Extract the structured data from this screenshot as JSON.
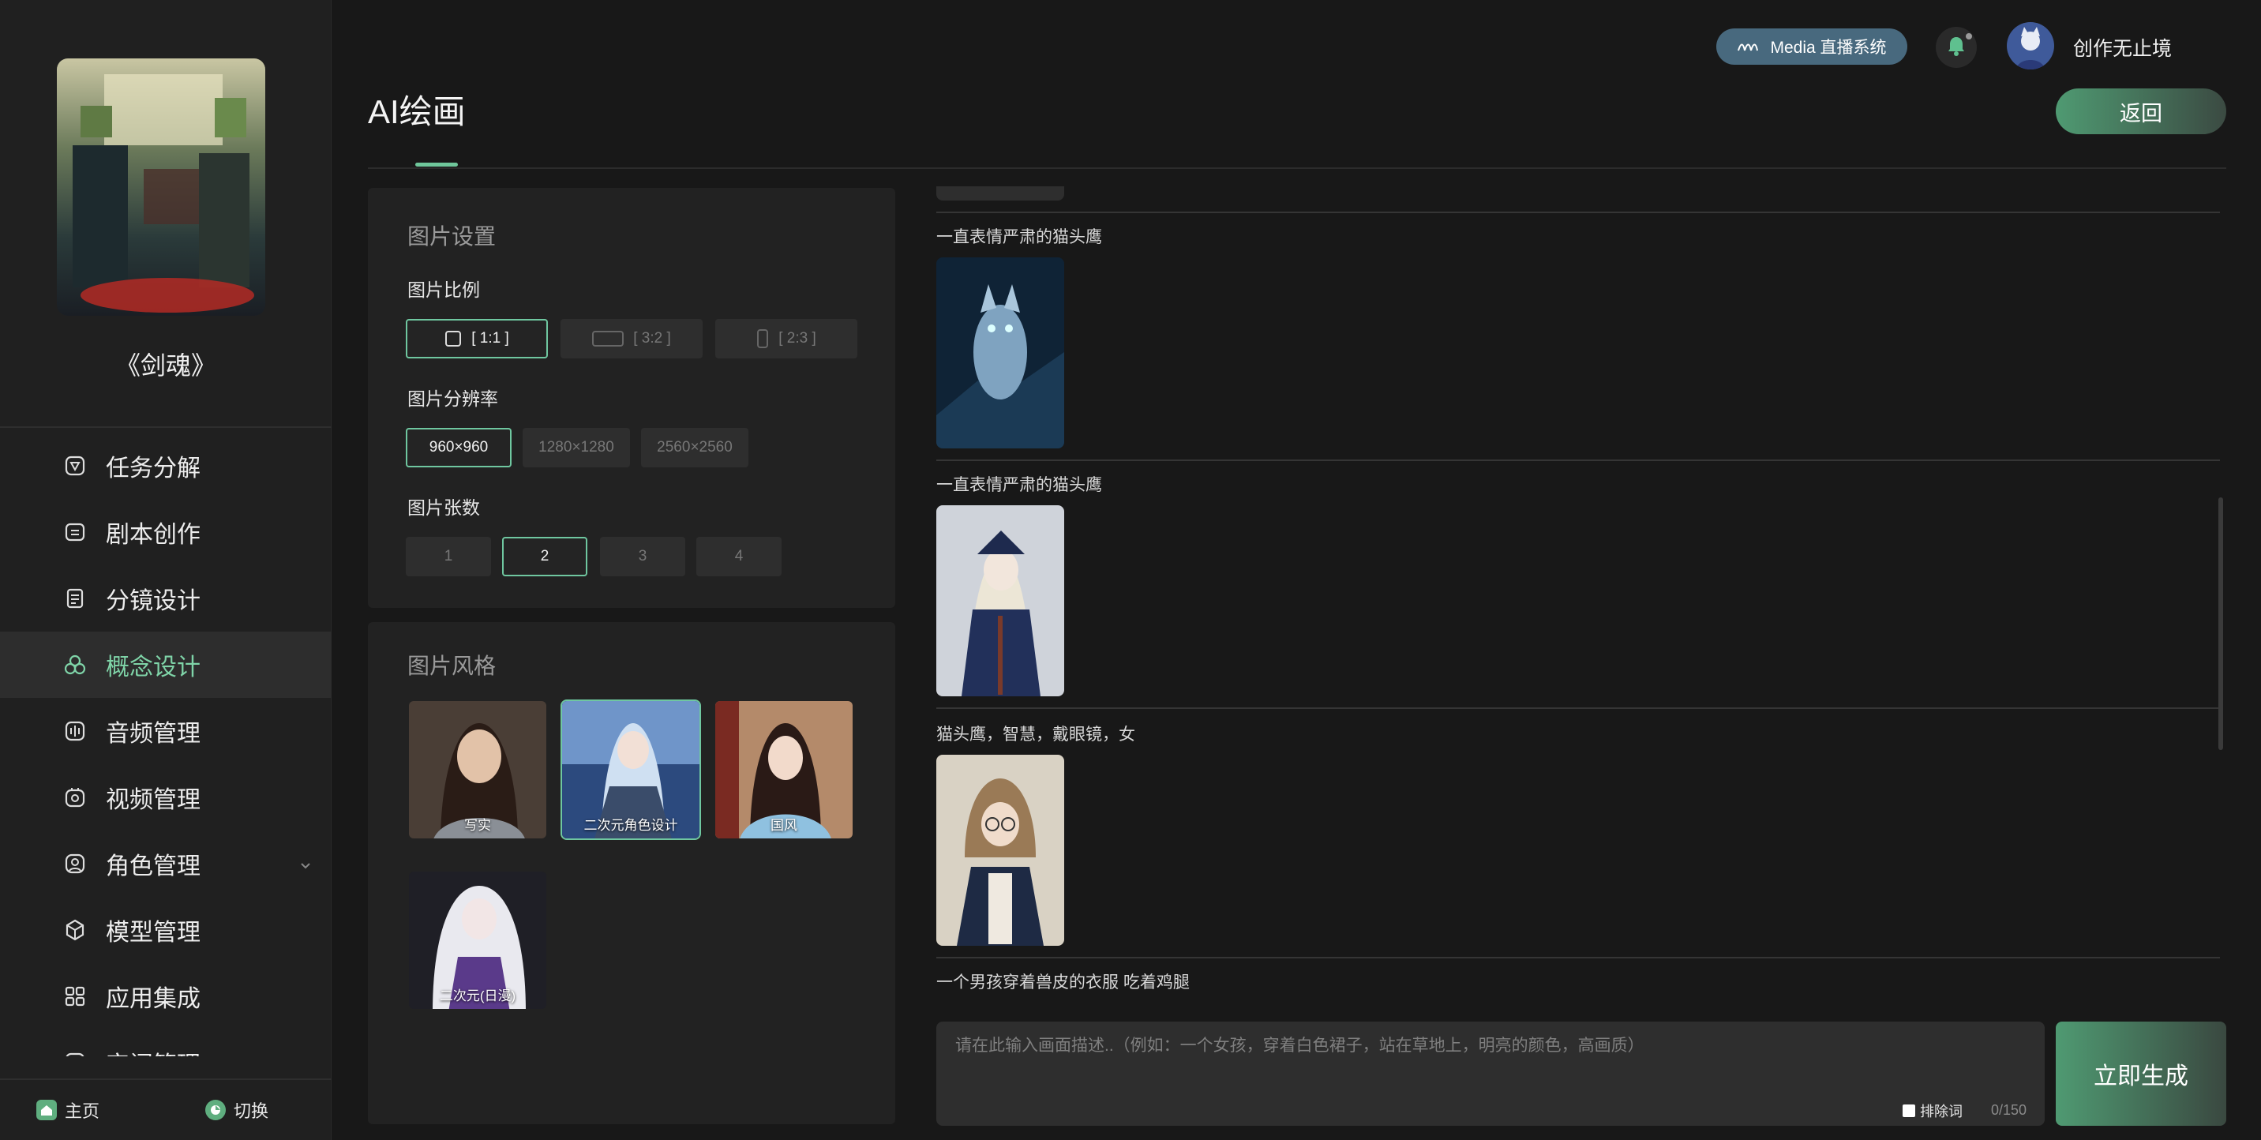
{
  "app": {
    "page_title": "AI绘画"
  },
  "sidebar": {
    "project_name": "《剑魂》",
    "items": [
      {
        "label": "任务分解",
        "icon": "task-icon"
      },
      {
        "label": "剧本创作",
        "icon": "script-icon"
      },
      {
        "label": "分镜设计",
        "icon": "storyboard-icon"
      },
      {
        "label": "概念设计",
        "icon": "concept-icon",
        "active": true
      },
      {
        "label": "音频管理",
        "icon": "audio-icon"
      },
      {
        "label": "视频管理",
        "icon": "video-icon"
      },
      {
        "label": "角色管理",
        "icon": "role-icon"
      },
      {
        "label": "模型管理",
        "icon": "model-icon"
      },
      {
        "label": "应用集成",
        "icon": "apps-icon"
      },
      {
        "label": "审阅管理",
        "icon": "review-icon"
      }
    ],
    "home_label": "主页",
    "switch_label": "切换"
  },
  "header": {
    "media_label": "Media 直播系统",
    "username": "创作无止境",
    "back_label": "返回"
  },
  "settings": {
    "title": "图片设置",
    "ratio_label": "图片比例",
    "ratios": [
      "[ 1:1 ]",
      "[ 3:2 ]",
      "[ 2:3 ]"
    ],
    "resolution_label": "图片分辨率",
    "resolutions": [
      "960×960",
      "1280×1280",
      "2560×2560"
    ],
    "count_label": "图片张数",
    "counts": [
      "1",
      "2",
      "3",
      "4"
    ],
    "selected": {
      "ratio": 0,
      "resolution": 0,
      "count": 1
    }
  },
  "style": {
    "title": "图片风格",
    "items": [
      "写实",
      "二次元角色设计",
      "国风",
      "二次元(日漫)"
    ],
    "selected": 1
  },
  "feed": {
    "items": [
      {
        "prompt": "一直表情严肃的猫头鹰"
      },
      {
        "prompt": "一直表情严肃的猫头鹰"
      },
      {
        "prompt": "猫头鹰，智慧，戴眼镜，女"
      },
      {
        "prompt": "一个男孩穿着兽皮的衣服 吃着鸡腿"
      }
    ]
  },
  "input": {
    "placeholder": "请在此输入画面描述..（例如：一个女孩，穿着白色裙子，站在草地上，明亮的颜色，高画质）",
    "negative_label": "排除词",
    "counter": "0/150",
    "generate_label": "立即生成"
  },
  "colors": {
    "accent": "#6fc79b",
    "background": "#181818",
    "panel": "#222222",
    "media_badge": "#48697e"
  }
}
